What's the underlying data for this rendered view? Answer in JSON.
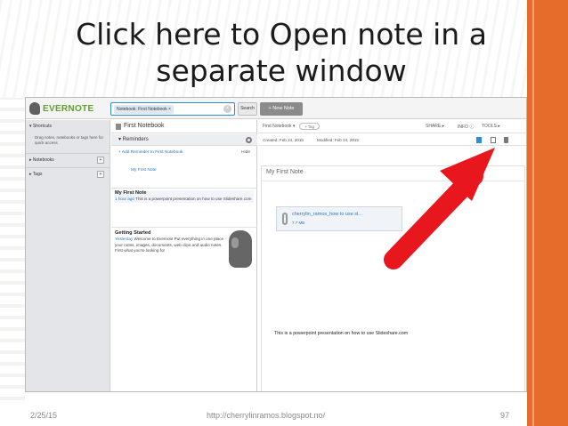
{
  "slide": {
    "title_line1": "Click here to Open note in a",
    "title_line2": "separate window",
    "footer_date": "2/25/15",
    "footer_url": "http://cherrylinramos.blogspot.no/",
    "slide_number": "97",
    "accent_color": "#e66c2c",
    "arrow_color": "#e8171d"
  },
  "app": {
    "logo": "EVERNOTE",
    "search": {
      "chip": "Notebook: First Notebook ×",
      "button": "Search"
    },
    "new_note": "+ New Note",
    "sidebar": {
      "shortcuts": "▾ Shortcuts",
      "hint": "Drag notes, notebooks or tags here for quick access",
      "notebooks": "▸ Notebooks",
      "tags": "▸ Tags",
      "plus": "+"
    },
    "notelist": {
      "title": "First Notebook",
      "reminders": "▾ Reminders",
      "add_reminder": "+ Add Reminder to First Notebook",
      "hide": "Hide",
      "reminder_item": "My First Note",
      "cards": [
        {
          "title": "My First Note",
          "time": "1 hour ago",
          "body": "This is a powerpoint presentation on how to use Slideshare.com"
        },
        {
          "title": "Getting Started",
          "time": "Yesterday",
          "body": "Welcome to Evernote Put everything in one place - your notes, images, documents, web clips and audio notes. First what you're looking for"
        }
      ]
    },
    "editor": {
      "notebook": "First Notebook ▾",
      "tag": "+ Tag",
      "share": "SHARE ▸",
      "info": "INFO ⓘ",
      "tools": "TOOLS ▸",
      "created": "Created: Feb 24, 2015",
      "modified": "Modified: Feb 24, 2015",
      "title": "My First Note",
      "attachment_name": "cherrylin_ramos_how to use sl...",
      "attachment_size": "7.7 MB",
      "text": "This is a powerpoint presentation on how to use Slideshare.com"
    }
  }
}
